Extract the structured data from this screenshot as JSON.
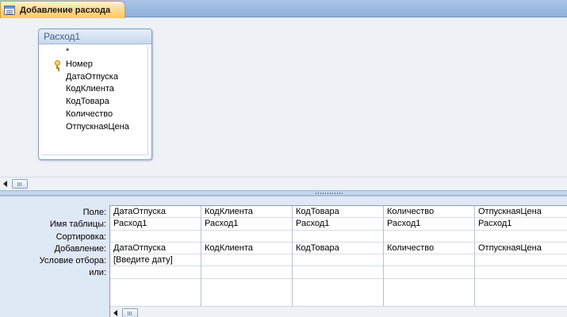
{
  "tab": {
    "title": "Добавление расхода",
    "icon": "query-icon"
  },
  "field_list": {
    "title": "Расход1",
    "fields": [
      {
        "label": "*",
        "key": false
      },
      {
        "label": "Номер",
        "key": true
      },
      {
        "label": "ДатаОтпуска",
        "key": false
      },
      {
        "label": "КодКлиента",
        "key": false
      },
      {
        "label": "КодТовара",
        "key": false
      },
      {
        "label": "Количество",
        "key": false
      },
      {
        "label": "ОтпускнаяЦена",
        "key": false
      }
    ]
  },
  "design_grid": {
    "row_labels": [
      "Поле:",
      "Имя таблицы:",
      "Сортировка:",
      "Добавление:",
      "Условие отбора:",
      "или:"
    ],
    "columns": [
      {
        "field": "ДатаОтпуска",
        "table": "Расход1",
        "sort": "",
        "append": "ДатаОтпуска",
        "criteria": "[Введите дату]",
        "or": ""
      },
      {
        "field": "КодКлиента",
        "table": "Расход1",
        "sort": "",
        "append": "КодКлиента",
        "criteria": "",
        "or": ""
      },
      {
        "field": "КодТовара",
        "table": "Расход1",
        "sort": "",
        "append": "КодТовара",
        "criteria": "",
        "or": ""
      },
      {
        "field": "Количество",
        "table": "Расход1",
        "sort": "",
        "append": "Количество",
        "criteria": "",
        "or": ""
      },
      {
        "field": "ОтпускнаяЦена",
        "table": "Расход1",
        "sort": "",
        "append": "ОтпускнаяЦена",
        "criteria": "",
        "or": ""
      }
    ]
  }
}
